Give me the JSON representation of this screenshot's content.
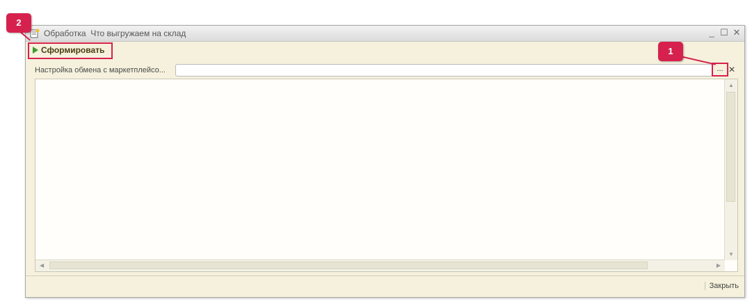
{
  "window": {
    "title": "Обработка  Что выгружаем на склад",
    "controls": {
      "minimize": "_",
      "maximize": "☐",
      "close": "✕"
    }
  },
  "toolbar": {
    "run_label": "Сформировать"
  },
  "field": {
    "label": "Настройка обмена с маркетплейсо...",
    "value": "",
    "select_button": "...",
    "clear_button": "✕"
  },
  "scroll": {
    "up": "▲",
    "down": "▼",
    "left": "◀",
    "right": "▶"
  },
  "footer": {
    "close_label": "Закрыть"
  },
  "callouts": [
    {
      "number": "1"
    },
    {
      "number": "2"
    }
  ],
  "colors": {
    "accent": "#d6214e",
    "run_icon": "#3f9b2b",
    "window_bg": "#f5f1dc"
  }
}
